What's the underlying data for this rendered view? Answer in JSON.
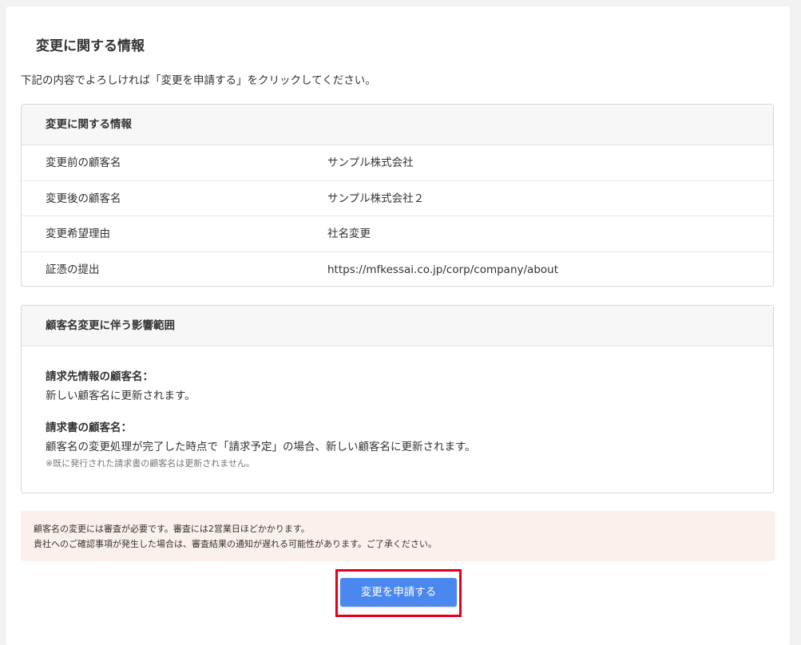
{
  "page": {
    "title": "変更に関する情報",
    "instruction": "下記の内容でよろしければ「変更を申請する」をクリックしてください。"
  },
  "info_card": {
    "header": "変更に関する情報",
    "rows": [
      {
        "label": "変更前の顧客名",
        "value": "サンプル株式会社"
      },
      {
        "label": "変更後の顧客名",
        "value": "サンプル株式会社２"
      },
      {
        "label": "変更希望理由",
        "value": "社名変更"
      },
      {
        "label": "証憑の提出",
        "value": "https://mfkessai.co.jp/corp/company/about"
      }
    ]
  },
  "impact_card": {
    "header": "顧客名変更に伴う影響範囲",
    "items": [
      {
        "heading": "請求先情報の顧客名：",
        "text": "新しい顧客名に更新されます。",
        "note": ""
      },
      {
        "heading": "請求書の顧客名：",
        "text": "顧客名の変更処理が完了した時点で「請求予定」の場合、新しい顧客名に更新されます。",
        "note": "※既に発行された請求書の顧客名は更新されません。"
      }
    ]
  },
  "notice": {
    "line1": "顧客名の変更には審査が必要です。審査には2営業日ほどかかります。",
    "line2": "貴社へのご確認事項が発生した場合は、審査結果の通知が遅れる可能性があります。ご了承ください。",
    "background_color": "#fcf0ec"
  },
  "submit": {
    "label": "変更を申請する",
    "button_color": "#4a88f0",
    "highlight_color": "#e2001a"
  }
}
